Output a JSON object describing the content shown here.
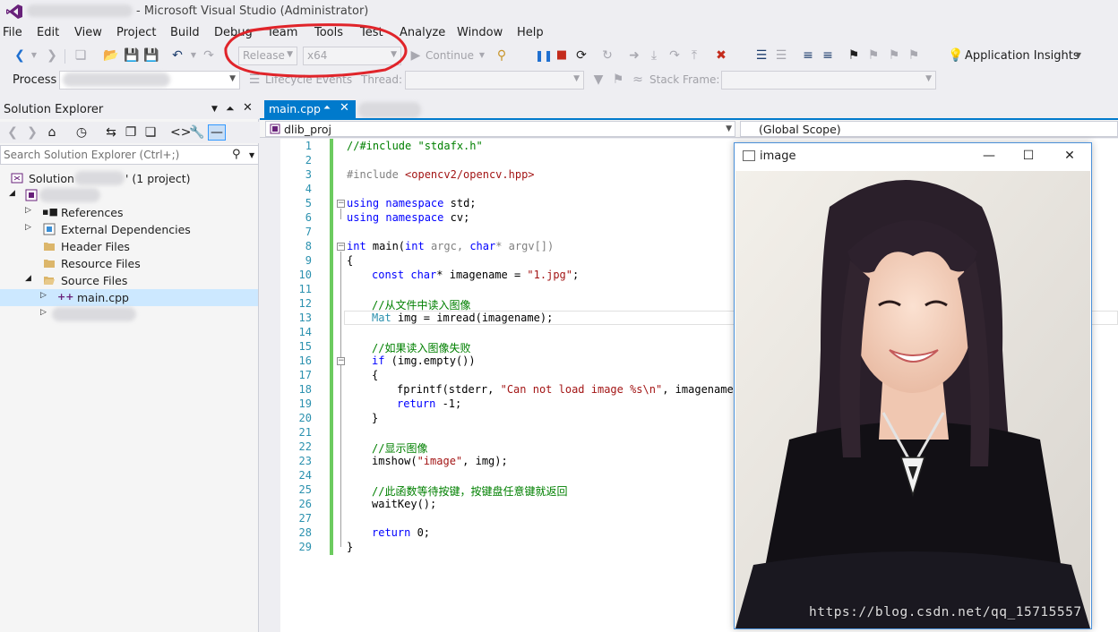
{
  "window": {
    "title": "- Microsoft Visual Studio (Administrator)"
  },
  "menu": [
    "File",
    "Edit",
    "View",
    "Project",
    "Build",
    "Debug",
    "Team",
    "Tools",
    "Test",
    "Analyze",
    "Window",
    "Help"
  ],
  "toolbar": {
    "configuration": "Release",
    "platform": "x64",
    "continue": "Continue",
    "app_insights": "Application Insights"
  },
  "debug_toolbar": {
    "process_label": "Process",
    "lifecycle": "Lifecycle Events",
    "thread_label": "Thread:",
    "stack_frame_label": "Stack Frame:"
  },
  "solution_explorer": {
    "title": "Solution Explorer",
    "search_placeholder": "Search Solution Explorer (Ctrl+;)",
    "solution_label": "Solution",
    "solution_suffix": "' (1 project)",
    "items": [
      {
        "label": "References"
      },
      {
        "label": "External Dependencies"
      },
      {
        "label": "Header Files"
      },
      {
        "label": "Resource Files"
      },
      {
        "label": "Source Files"
      },
      {
        "label": "main.cpp"
      }
    ]
  },
  "editor": {
    "tab": "main.cpp",
    "nav_left": "dlib_proj",
    "nav_right": "(Global Scope)",
    "line_numbers": [
      "1",
      "2",
      "3",
      "4",
      "5",
      "6",
      "7",
      "8",
      "9",
      "10",
      "11",
      "12",
      "13",
      "14",
      "15",
      "16",
      "17",
      "18",
      "19",
      "20",
      "21",
      "22",
      "23",
      "24",
      "25",
      "26",
      "27",
      "28",
      "29"
    ]
  },
  "code": {
    "l1": "//#include \"stdafx.h\"",
    "l3a": "#include ",
    "l3b": "<opencv2/opencv.hpp>",
    "using": "using",
    "namespace": "namespace",
    "std": " std;",
    "cv": " cv;",
    "int": "int",
    "main": " main(",
    "argc": " argc, ",
    "char": "char",
    "argv": "* argv[])",
    "brace_open": "{",
    "brace_close": "}",
    "const": "const",
    "imagename_decl": "* imagename = ",
    "jpg": "\"1.jpg\"",
    "semi": ";",
    "c12": "//从文件中读入图像",
    "mat": "Mat",
    "imread": " img = imread(imagename);",
    "c15": "//如果读入图像失败",
    "if": "if",
    "empty": " (img.empty())",
    "fprintf": "fprintf(stderr, ",
    "errstr": "\"Can not load image %s\\n\"",
    "fprintf_end": ", imagename);",
    "return": "return",
    "ret1": " -1;",
    "c22": "//显示图像",
    "imshow_a": "imshow(",
    "imshow_s": "\"image\"",
    "imshow_b": ", img);",
    "c25": "//此函数等待按键，按键盘任意键就返回",
    "waitkey": "waitKey();",
    "ret0": " 0;"
  },
  "image_window": {
    "title": "image"
  },
  "watermark": "https://blog.csdn.net/qq_15715557",
  "colors": {
    "accent": "#007acc",
    "selection": "#cce8ff",
    "change_bar": "#6ccb5f",
    "annotation": "#e0242a"
  }
}
